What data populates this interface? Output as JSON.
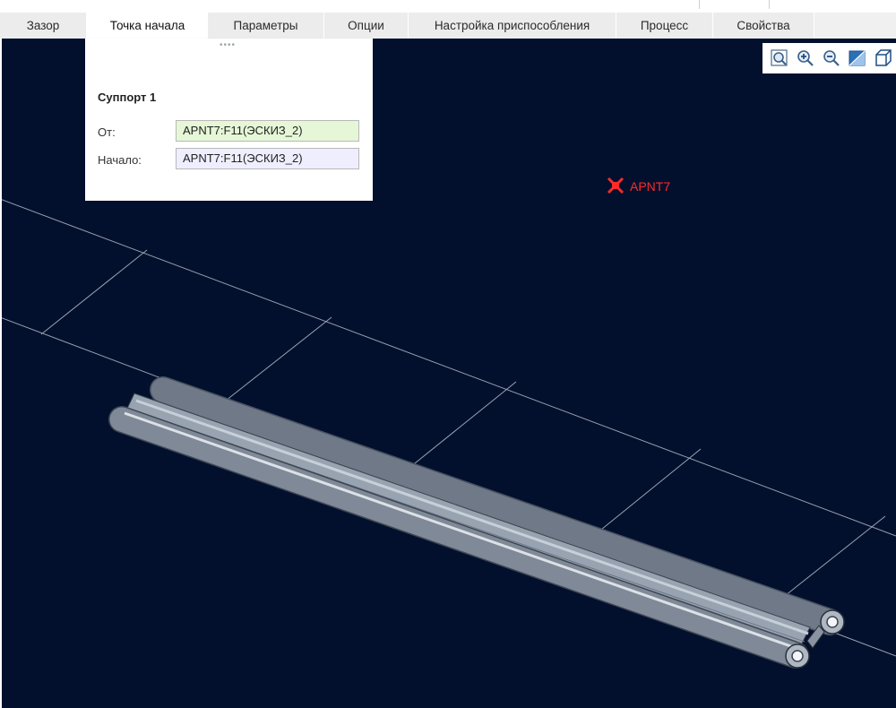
{
  "tabs": [
    {
      "label": "Зазор"
    },
    {
      "label": "Точка начала",
      "active": true
    },
    {
      "label": "Параметры"
    },
    {
      "label": "Опции"
    },
    {
      "label": "Настройка приспособления"
    },
    {
      "label": "Процесс"
    },
    {
      "label": "Свойства"
    }
  ],
  "panel": {
    "title": "Суппорт 1",
    "from_label": "От:",
    "from_value": "APNT7:F11(ЭСКИЗ_2)",
    "start_label": "Начало:",
    "start_value": "APNT7:F11(ЭСКИЗ_2)"
  },
  "viewport": {
    "point_label": "APNT7",
    "point_icon": "datum-point-icon",
    "background_color": "#02102e",
    "point_color": "#ff2a2a"
  },
  "view_tools": [
    {
      "name": "zoom-fit-icon"
    },
    {
      "name": "zoom-in-icon"
    },
    {
      "name": "zoom-out-icon"
    },
    {
      "name": "shaded-display-icon"
    },
    {
      "name": "saved-views-icon"
    }
  ]
}
